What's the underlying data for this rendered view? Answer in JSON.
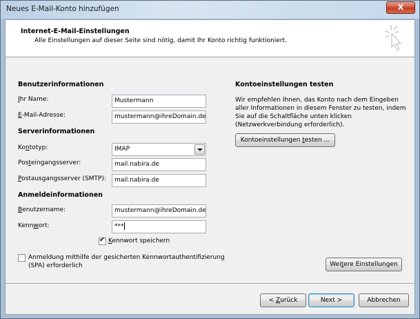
{
  "window": {
    "title": "Neues E-Mail-Konto hinzufügen",
    "close_label": "X"
  },
  "header": {
    "title": "Internet-E-Mail-Einstellungen",
    "subtitle": "Alle Einstellungen auf dieser Seite sind nötig, damit Ihr Konto richtig funktioniert.",
    "icon": "sparkle-cursor-icon"
  },
  "user_info": {
    "heading": "Benutzerinformationen",
    "name_label_key": "I",
    "name_label_rest": "hr Name:",
    "name_value": "Mustermann",
    "email_label_key": "E",
    "email_label_rest": "-Mail-Adresse:",
    "email_value": "mustermann@ihreDomain.de"
  },
  "server_info": {
    "heading": "Serverinformationen",
    "account_type_label_pre": "Ko",
    "account_type_label_key": "n",
    "account_type_label_post": "totyp:",
    "account_type_value": "IMAP",
    "incoming_label_pre": "Pos",
    "incoming_label_key": "t",
    "incoming_label_post": "eingangsserver:",
    "incoming_value": "mail.nabira.de",
    "outgoing_label_key": "P",
    "outgoing_label_rest": "ostausgangsserver (SMTP):",
    "outgoing_value": "mail.nabira.de"
  },
  "logon_info": {
    "heading": "Anmeldeinformationen",
    "username_label_key": "B",
    "username_label_rest": "enutzername:",
    "username_value": "mustermann@ihreDomain.de",
    "password_label_pre": "Kenn",
    "password_label_key": "w",
    "password_label_post": "ort:",
    "password_value": "***",
    "remember_label_key": "K",
    "remember_label_rest": "ennwort speichern",
    "remember_checked": true,
    "spa_label_line1": "Anmeldung mithilfe der gesicherten Kennwortauthentifizierung",
    "spa_label_line2": "(SPA) erforderlich",
    "spa_checked": false
  },
  "test_settings": {
    "heading": "Kontoeinstellungen testen",
    "description_line1": "Wir empfehlen Ihnen, das Konto nach dem Eingeben",
    "description_line2": "aller Informationen in diesem Fenster zu testen, indem",
    "description_line3": "Sie auf die Schaltfläche unten klicken",
    "description_line4": "(Netzwerkverbindung erforderlich).",
    "test_button_pre": "Kontoeinstellungen ",
    "test_button_key": "t",
    "test_button_post": "esten ..."
  },
  "more_settings_pre": "Wei",
  "more_settings_key": "t",
  "more_settings_post": "ere Einstellungen",
  "footer": {
    "back_pre": "< ",
    "back_key": "Z",
    "back_post": "urück",
    "next": "Next >",
    "cancel": "Abbrechen"
  }
}
